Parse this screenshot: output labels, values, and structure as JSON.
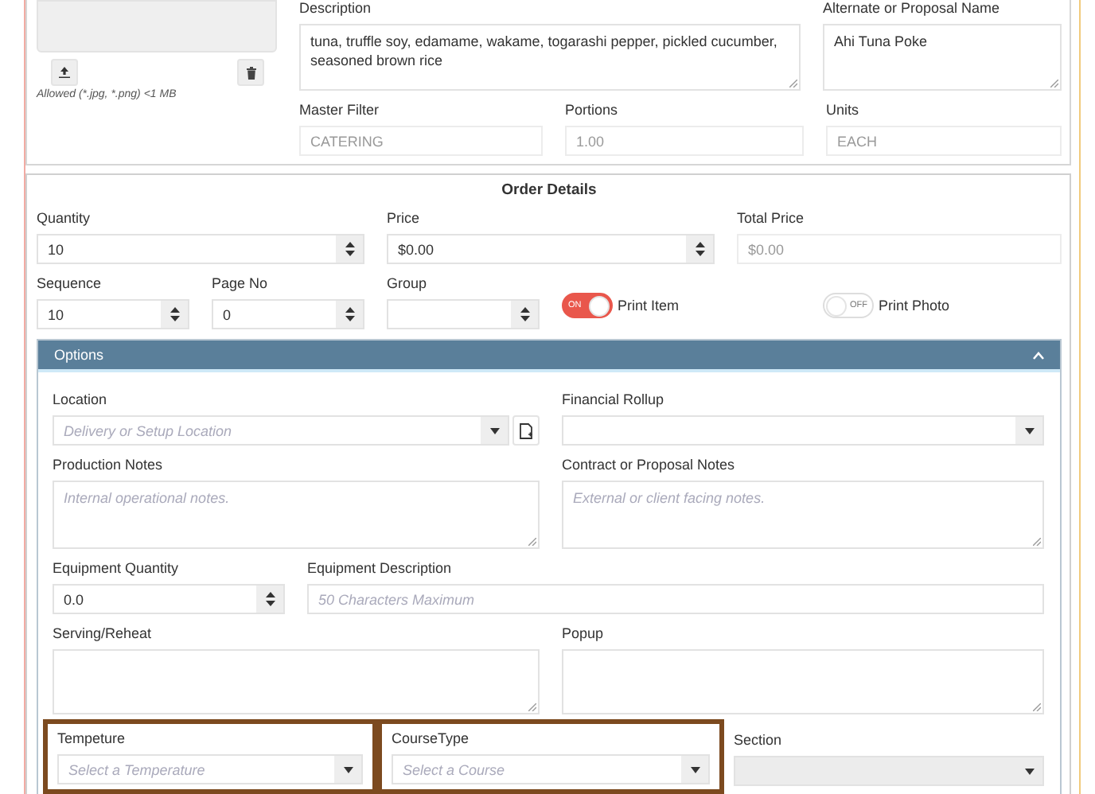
{
  "media": {
    "hint": "Allowed (*.jpg, *.png) <1 MB"
  },
  "item_rows": [
    [
      {
        "kind": "textarea",
        "label": "Description",
        "value": "tuna, truffle soy, edamame, wakame,  togarashi pepper,  pickled cucumber, seasoned brown rice"
      },
      {
        "kind": "textarea",
        "label": "Alternate or Proposal Name",
        "value": "Ahi Tuna Poke"
      }
    ],
    [
      {
        "kind": "readonly",
        "label": "Master Filter",
        "value": "CATERING"
      },
      {
        "kind": "readonly",
        "label": "Portions",
        "value": "1.00"
      },
      {
        "kind": "readonly",
        "label": "Units",
        "value": "EACH"
      }
    ]
  ],
  "order_details": {
    "title": "Order Details",
    "field_groups": [
      [
        {
          "kind": "number",
          "label": "Quantity",
          "value": "10"
        },
        {
          "kind": "number",
          "label": "Price",
          "value": "$0.00"
        },
        {
          "kind": "readonly",
          "label": "Total Price",
          "value": "$0.00"
        }
      ],
      [
        {
          "kind": "number",
          "label": "Sequence",
          "value": "10"
        },
        {
          "kind": "number",
          "label": "Page No",
          "value": "0"
        },
        {
          "kind": "number",
          "label": "Group"
        },
        {
          "kind": "toggle",
          "label": "Print Item",
          "on": true,
          "switch_text": "ON"
        },
        {
          "kind": "toggle",
          "label": "Print Photo",
          "on": false,
          "switch_text": "OFF"
        }
      ]
    ]
  },
  "options": {
    "title": "Options",
    "expanded": true,
    "field_groups": [
      [
        {
          "kind": "select_doc",
          "label": "Location",
          "placeholder": "Delivery or Setup Location",
          "highlighted": false
        },
        {
          "kind": "select",
          "label": "Financial Rollup",
          "highlighted": false
        }
      ],
      [
        {
          "kind": "textarea",
          "label": "Production Notes",
          "placeholder": "Internal operational notes.",
          "highlighted": false
        },
        {
          "kind": "textarea",
          "label": "Contract or Proposal Notes",
          "placeholder": "External or client facing notes.",
          "highlighted": false
        }
      ],
      [
        {
          "kind": "number",
          "label": "Equipment Quantity",
          "value": "0.0",
          "highlighted": false
        },
        {
          "kind": "text",
          "label": "Equipment Description",
          "placeholder": "50 Characters Maximum",
          "highlighted": false
        }
      ],
      [
        {
          "kind": "textarea",
          "label": "Serving/Reheat",
          "highlighted": false
        },
        {
          "kind": "textarea",
          "label": "Popup",
          "highlighted": false
        }
      ],
      [
        {
          "kind": "select",
          "label": "Tempeture",
          "placeholder": "Select a Temperature",
          "highlighted": true
        },
        {
          "kind": "select",
          "label": "CourseType",
          "placeholder": "Select a Course",
          "highlighted": true
        },
        {
          "kind": "select_disabled",
          "label": "Section",
          "highlighted": false
        }
      ]
    ]
  }
}
